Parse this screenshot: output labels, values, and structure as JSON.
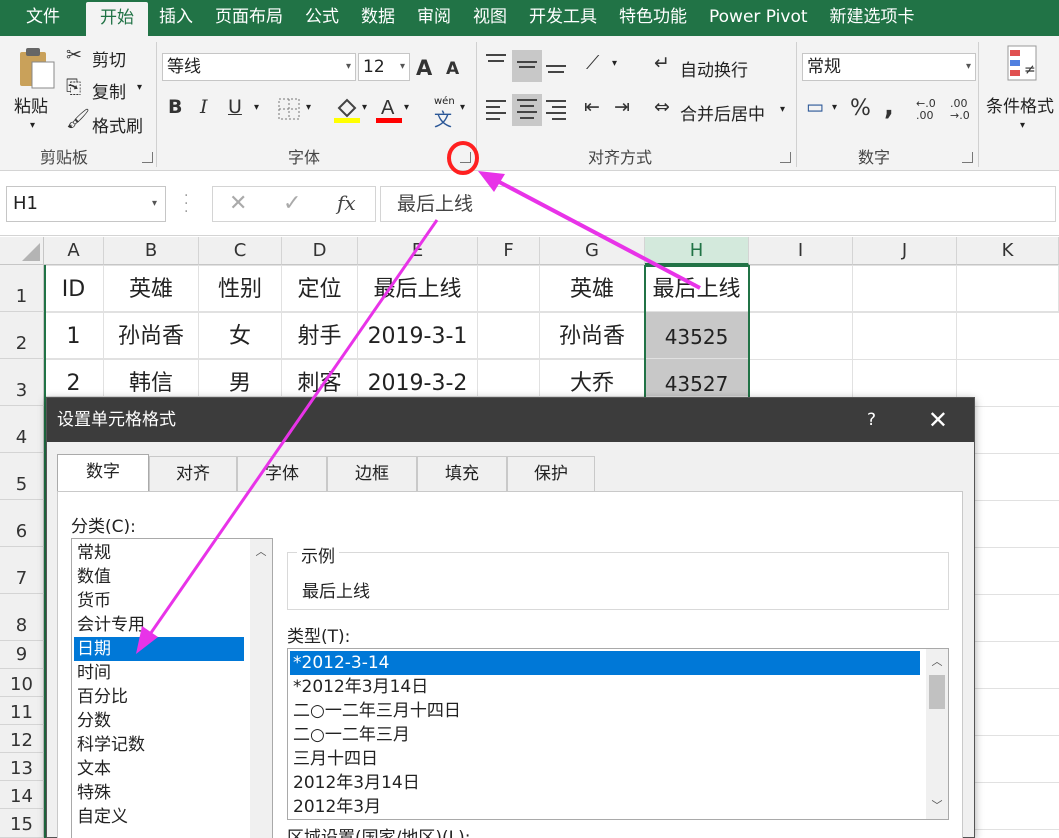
{
  "ribbon_tabs": [
    "文件",
    "开始",
    "插入",
    "页面布局",
    "公式",
    "数据",
    "审阅",
    "视图",
    "开发工具",
    "特色功能",
    "Power Pivot",
    "新建选项卡"
  ],
  "clipboard": {
    "paste": "粘贴",
    "cut": "剪切",
    "copy": "复制",
    "format_painter": "格式刷",
    "label": "剪贴板"
  },
  "font": {
    "name": "等线",
    "size": "12",
    "label": "字体",
    "bold": "B",
    "italic": "I",
    "underline": "U",
    "grow": "A",
    "shrink": "A",
    "pinyin_top": "wén",
    "pinyin_char": "文"
  },
  "alignment": {
    "wrap": "自动换行",
    "merge": "合并后居中",
    "label": "对齐方式"
  },
  "number": {
    "format": "常规",
    "label": "数字",
    "percent": "%",
    "comma": ","
  },
  "styles": {
    "conditional": "条件格式"
  },
  "formula_bar": {
    "name_box": "H1",
    "formula": "最后上线",
    "fx": "fx"
  },
  "columns": [
    "A",
    "B",
    "C",
    "D",
    "E",
    "F",
    "G",
    "H",
    "I",
    "J",
    "K"
  ],
  "rows": [
    "1",
    "2",
    "3",
    "4",
    "5",
    "6",
    "7",
    "8",
    "9",
    "10",
    "11",
    "12",
    "13",
    "14",
    "15"
  ],
  "cells": {
    "r1": [
      "ID",
      "英雄",
      "性别",
      "定位",
      "最后上线",
      "",
      "英雄",
      "最后上线"
    ],
    "r2": [
      "1",
      "孙尚香",
      "女",
      "射手",
      "2019-3-1",
      "",
      "孙尚香",
      "43525"
    ],
    "r3": [
      "2",
      "韩信",
      "男",
      "刺客",
      "2019-3-2",
      "",
      "大乔",
      "43527"
    ]
  },
  "dialog": {
    "title": "设置单元格格式",
    "help": "?",
    "close": "✕",
    "tabs": [
      "数字",
      "对齐",
      "字体",
      "边框",
      "填充",
      "保护"
    ],
    "category_label": "分类(C):",
    "categories": [
      "常规",
      "数值",
      "货币",
      "会计专用",
      "日期",
      "时间",
      "百分比",
      "分数",
      "科学记数",
      "文本",
      "特殊",
      "自定义"
    ],
    "selected_category": "日期",
    "sample_label": "示例",
    "sample_value": "最后上线",
    "type_label": "类型(T):",
    "types": [
      "*2012-3-14",
      "*2012年3月14日",
      "二○一二年三月十四日",
      "二○一二年三月",
      "三月十四日",
      "2012年3月14日",
      "2012年3月"
    ],
    "locale_label": "区域设置(国家/地区)(L):"
  },
  "colors": {
    "excel_green": "#217346",
    "highlight_blue": "#0078d7",
    "annotation_magenta": "#e833e8",
    "annotation_red": "#ff2020"
  }
}
